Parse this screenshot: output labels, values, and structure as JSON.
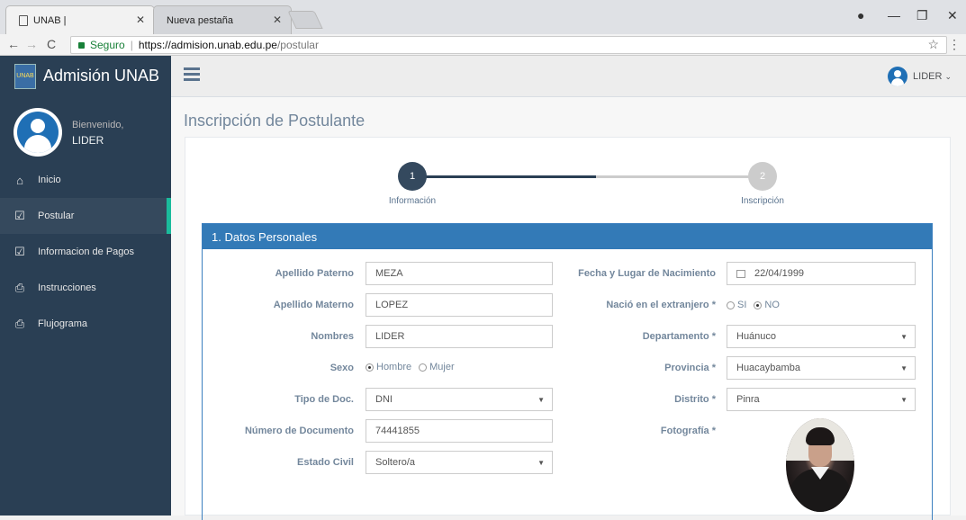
{
  "browser": {
    "tabs": [
      {
        "title": "UNAB |",
        "active": true
      },
      {
        "title": "Nueva pestaña",
        "active": false
      }
    ],
    "security_label": "Seguro",
    "url_scheme_host": "https://admision.unab.edu.pe",
    "url_path": "/postular"
  },
  "sidebar": {
    "brand": "Admisión UNAB",
    "logo_text": "UNAB",
    "welcome": "Bienvenido,",
    "username": "LIDER",
    "items": [
      {
        "label": "Inicio",
        "icon": "home-icon",
        "active": false
      },
      {
        "label": "Postular",
        "icon": "checkbox-edit-icon",
        "active": true
      },
      {
        "label": "Informacion de Pagos",
        "icon": "checkbox-edit-icon",
        "active": false
      },
      {
        "label": "Instrucciones",
        "icon": "pdf-icon",
        "active": false
      },
      {
        "label": "Flujograma",
        "icon": "pdf-icon",
        "active": false
      }
    ]
  },
  "topnav": {
    "user_label": "LIDER"
  },
  "page": {
    "title": "Inscripción de Postulante"
  },
  "wizard": {
    "steps": [
      {
        "number": "1",
        "label": "Información",
        "state": "done"
      },
      {
        "number": "2",
        "label": "Inscripción",
        "state": "pending"
      }
    ]
  },
  "form": {
    "section_title": "1. Datos Personales",
    "left": {
      "apellido_paterno": {
        "label": "Apellido Paterno",
        "value": "MEZA"
      },
      "apellido_materno": {
        "label": "Apellido Materno",
        "value": "LOPEZ"
      },
      "nombres": {
        "label": "Nombres",
        "value": "LIDER"
      },
      "sexo": {
        "label": "Sexo",
        "options": [
          "Hombre",
          "Mujer"
        ],
        "selected": "Hombre"
      },
      "tipo_doc": {
        "label": "Tipo de Doc.",
        "value": "DNI"
      },
      "numero_doc": {
        "label": "Número de Documento",
        "value": "74441855"
      },
      "estado_civil": {
        "label": "Estado Civil",
        "value": "Soltero/a"
      }
    },
    "right": {
      "fecha": {
        "label": "Fecha y Lugar de Nacimiento",
        "value": "22/04/1999"
      },
      "extranjero": {
        "label": "Nació en el extranjero *",
        "options": [
          "SI",
          "NO"
        ],
        "selected": "NO"
      },
      "departamento": {
        "label": "Departamento *",
        "value": "Huánuco"
      },
      "provincia": {
        "label": "Provincia *",
        "value": "Huacaybamba"
      },
      "distrito": {
        "label": "Distrito *",
        "value": "Pinra"
      },
      "fotografia": {
        "label": "Fotografía *"
      }
    }
  },
  "colors": {
    "sidebar_bg": "#2a3f54",
    "accent_green": "#1abb9c",
    "header_blue": "#337ab7",
    "step_done": "#2a3f54",
    "step_pending": "#cccccc"
  }
}
